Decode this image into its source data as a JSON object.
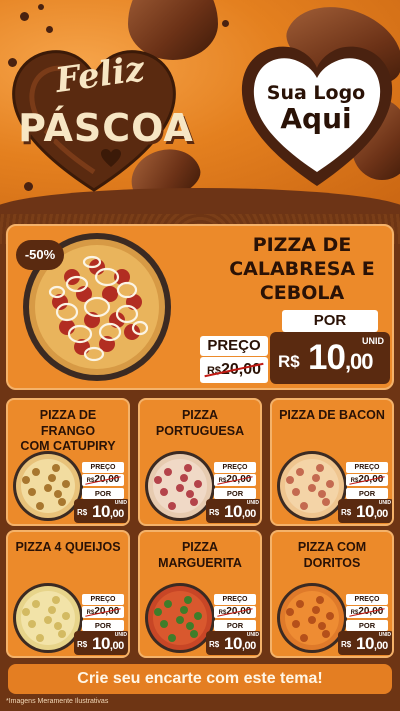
{
  "header": {
    "greeting_line1": "Feliz",
    "greeting_line2": "PÁSCOA",
    "logo_line1": "Sua Logo",
    "logo_line2": "Aqui"
  },
  "featured": {
    "discount_badge": "-50%",
    "title_line1": "PIZZA DE",
    "title_line2": "CALABRESA E",
    "title_line3": "CEBOLA",
    "price_label": "PREÇO",
    "currency": "R$",
    "old_price": "20,00",
    "por_label": "POR",
    "unit_label": "UNID",
    "new_price_int": "10",
    "new_price_dec": ",00"
  },
  "products": [
    {
      "title_line1": "PIZZA DE FRANGO",
      "title_line2": "COM CATUPIRY",
      "price_label": "PREÇO",
      "currency": "R$",
      "old_price": "20,00",
      "por_label": "POR",
      "unit_label": "UNID",
      "new_price_int": "10",
      "new_price_dec": ",00"
    },
    {
      "title_line1": "PIZZA",
      "title_line2": "PORTUGUESA",
      "price_label": "PREÇO",
      "currency": "R$",
      "old_price": "20,00",
      "por_label": "POR",
      "unit_label": "UNID",
      "new_price_int": "10",
      "new_price_dec": ",00"
    },
    {
      "title_line1": "PIZZA DE BACON",
      "title_line2": "",
      "price_label": "PREÇO",
      "currency": "R$",
      "old_price": "20,00",
      "por_label": "POR",
      "unit_label": "UNID",
      "new_price_int": "10",
      "new_price_dec": ",00"
    },
    {
      "title_line1": "PIZZA 4 QUEIJOS",
      "title_line2": "",
      "price_label": "PREÇO",
      "currency": "R$",
      "old_price": "20,00",
      "por_label": "POR",
      "unit_label": "UNID",
      "new_price_int": "10",
      "new_price_dec": ",00"
    },
    {
      "title_line1": "PIZZA",
      "title_line2": "MARGUERITA",
      "price_label": "PREÇO",
      "currency": "R$",
      "old_price": "20,00",
      "por_label": "POR",
      "unit_label": "UNID",
      "new_price_int": "10",
      "new_price_dec": ",00"
    },
    {
      "title_line1": "PIZZA COM",
      "title_line2": "DORITOS",
      "price_label": "PREÇO",
      "currency": "R$",
      "old_price": "20,00",
      "por_label": "POR",
      "unit_label": "UNID",
      "new_price_int": "10",
      "new_price_dec": ",00"
    }
  ],
  "footer": {
    "cta": "Crie seu encarte com este tema!",
    "disclaimer": "*Imagens Meramente Ilustrativas"
  },
  "colors": {
    "orange": "#ec8a2a",
    "chocolate": "#5a2a10",
    "cream": "#f7e6c4",
    "strike_red": "#c21a14"
  },
  "icons": [
    "chocolate-egg-icon",
    "heart-icon",
    "pizza-image"
  ]
}
